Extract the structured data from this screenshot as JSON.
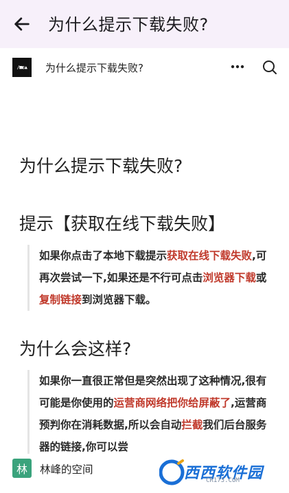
{
  "appbar": {
    "title": "为什么提示下载失败?"
  },
  "subbar": {
    "logo_text": "/■◐▲",
    "title": "为什么提示下载失败?"
  },
  "article": {
    "heading1": "为什么提示下载失败?",
    "heading2": "提示【获取在线下载失败】",
    "para1": [
      {
        "text": "如果你点击了本地下载提示",
        "highlight": false
      },
      {
        "text": "获取在线下载失败",
        "highlight": true
      },
      {
        "text": ",可再次尝试一下,如果还是不行可点击",
        "highlight": false
      },
      {
        "text": "浏览器下载",
        "highlight": true
      },
      {
        "text": "或",
        "highlight": false
      },
      {
        "text": "复制链接",
        "highlight": true
      },
      {
        "text": "到浏览器下载。",
        "highlight": false
      }
    ],
    "heading3": "为什么会这样?",
    "para2": [
      {
        "text": "如果你一直很正常但是突然出现了这种情况,很有可能是你使用的",
        "highlight": false
      },
      {
        "text": "运营商网络把你给屏蔽了",
        "highlight": true
      },
      {
        "text": ",运营商预判你在消耗数据,所以会自动",
        "highlight": false
      },
      {
        "text": "拦截",
        "highlight": true
      },
      {
        "text": "我们后台服务器的链接,你可以尝",
        "highlight": false
      }
    ]
  },
  "footer": {
    "avatar_char": "林",
    "space_name": "林峰的空间"
  },
  "watermark": {
    "text": "西西软件园",
    "sub": "CR173.COM"
  },
  "colors": {
    "appbar_bg": "#f7f0fa",
    "highlight": "#c0392b",
    "avatar_bg": "#3aa37c"
  }
}
